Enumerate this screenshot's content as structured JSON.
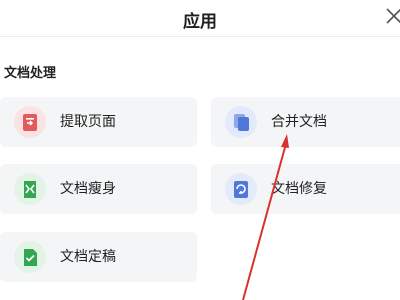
{
  "header": {
    "title": "应用"
  },
  "section": {
    "title": "文档处理"
  },
  "tools": [
    {
      "label": "提取页面",
      "icon": "extract-pages-icon",
      "color": "#e25b5b"
    },
    {
      "label": "合并文档",
      "icon": "merge-docs-icon",
      "color": "#4f78d8"
    },
    {
      "label": "文档瘦身",
      "icon": "slim-doc-icon",
      "color": "#35a453"
    },
    {
      "label": "文档修复",
      "icon": "repair-doc-icon",
      "color": "#4f78d8"
    },
    {
      "label": "文档定稿",
      "icon": "finalize-doc-icon",
      "color": "#35a453"
    }
  ],
  "annotation": {
    "color": "#d9312b"
  }
}
